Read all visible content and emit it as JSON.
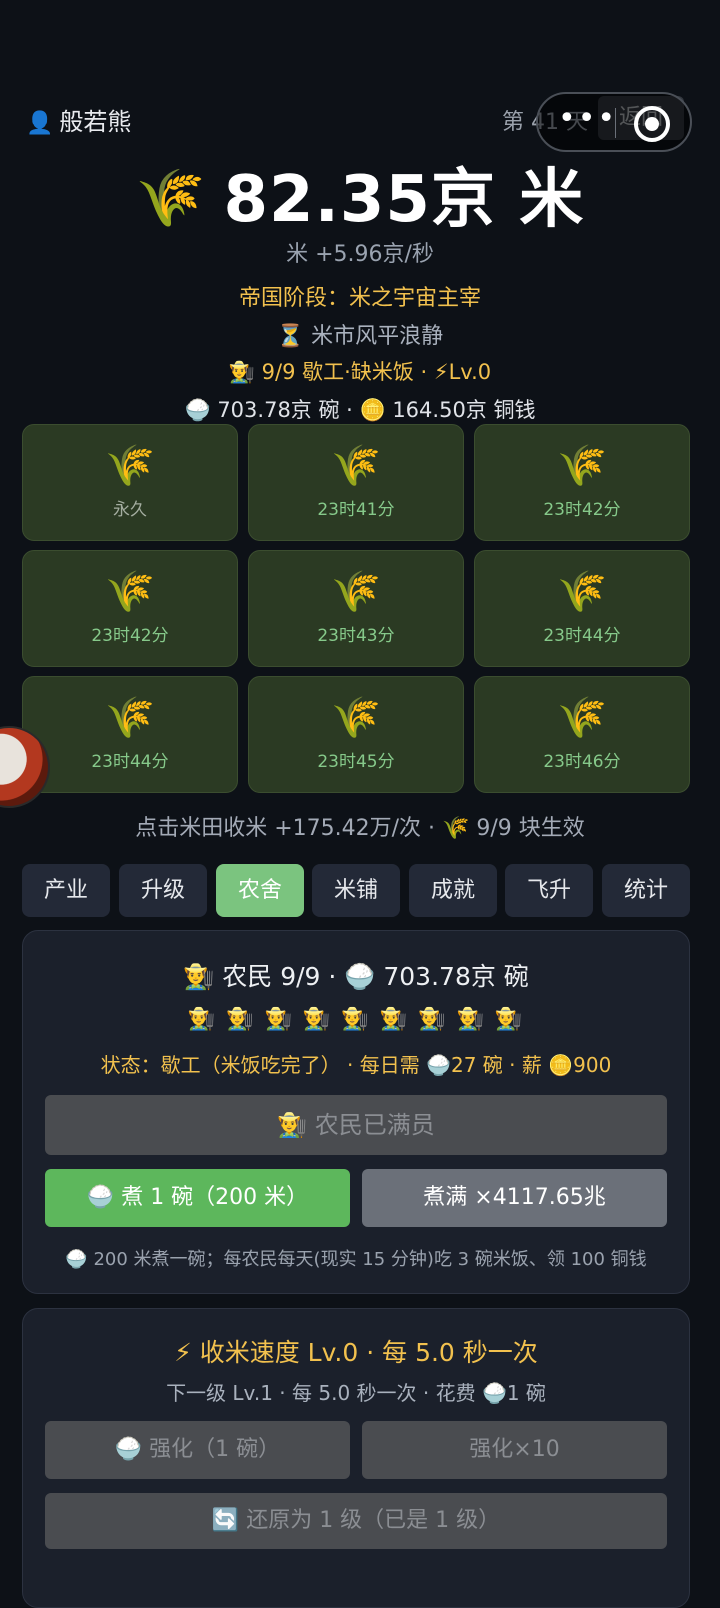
{
  "header": {
    "user_icon": "👤",
    "username": "般若熊",
    "day_label": "第 41 天",
    "back_label": "返回",
    "capsule_more": "•••"
  },
  "hero": {
    "icon": "🌾",
    "amount": "82.35京 米",
    "rate": "米 +5.96京/秒",
    "stage": "帝国阶段：米之宇宙主宰",
    "market": "⏳ 米市风平浪静",
    "farmers_status": "👨‍🌾 9/9 歇工·缺米饭 · ⚡Lv.0",
    "resources": "🍚 703.78京 碗 · 🪙 164.50京 铜钱"
  },
  "fields": [
    {
      "icon": "🌾",
      "label": "永久"
    },
    {
      "icon": "🌾",
      "label": "23时41分"
    },
    {
      "icon": "🌾",
      "label": "23时42分"
    },
    {
      "icon": "🌾",
      "label": "23时42分"
    },
    {
      "icon": "🌾",
      "label": "23时43分"
    },
    {
      "icon": "🌾",
      "label": "23时44分"
    },
    {
      "icon": "🌾",
      "label": "23时44分"
    },
    {
      "icon": "🌾",
      "label": "23时45分"
    },
    {
      "icon": "🌾",
      "label": "23时46分"
    }
  ],
  "click_info": "点击米田收米  +175.42万/次 · 🌾 9/9 块生效",
  "tabs": [
    "产业",
    "升级",
    "农舍",
    "米铺",
    "成就",
    "飞升",
    "统计"
  ],
  "active_tab": "农舍",
  "farmhouse": {
    "title": "👨‍🌾 农民 9/9 · 🍚 703.78京 碗",
    "farmers_row": "👨‍🌾 👨‍🌾 👨‍🌾 👨‍🌾 👨‍🌾 👨‍🌾 👨‍🌾 👨‍🌾 👨‍🌾",
    "status": "状态：歇工（米饭吃完了） · 每日需 🍚27 碗 · 薪 🪙900",
    "full_button": "👨‍🌾 农民已满员",
    "cook_one_button": "🍚 煮 1 碗（200 米）",
    "cook_full_button": "煮满 ×4117.65兆",
    "note": "🍚 200 米煮一碗；每农民每天(现实 15 分钟)吃 3 碗米饭、领 100 铜钱"
  },
  "speed": {
    "title": "⚡ 收米速度 Lv.0 · 每 5.0 秒一次",
    "next": "下一级 Lv.1 · 每 5.0 秒一次 · 花费 🍚1 碗",
    "upgrade_one": "🍚 强化（1 碗）",
    "upgrade_ten": "强化×10",
    "reset": "🔄 还原为 1 级（已是 1 级）"
  }
}
